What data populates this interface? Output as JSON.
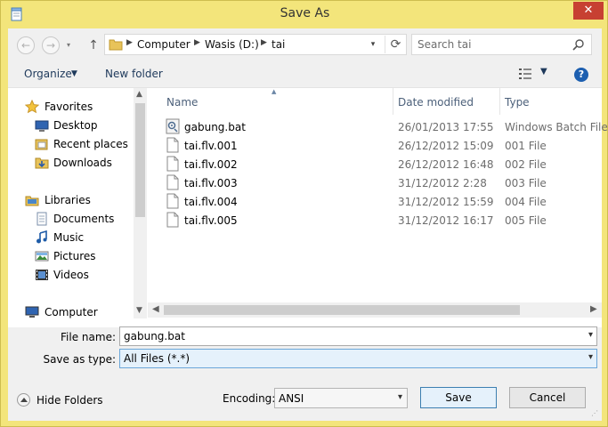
{
  "window": {
    "title": "Save As",
    "close_label": "✕"
  },
  "nav_buttons": {
    "back": "←",
    "forward": "→",
    "up": "↑"
  },
  "address": {
    "crumbs": [
      "Computer",
      "Wasis (D:)",
      "tai"
    ],
    "separator": "▶",
    "refresh": "⟳",
    "dropdown": "▾"
  },
  "search": {
    "placeholder": "Search tai"
  },
  "toolbar": {
    "organize_label": "Organize",
    "new_folder_label": "New folder",
    "help_label": "?"
  },
  "nav_pane": {
    "items": [
      {
        "label": "Favorites",
        "icon": "star-icon"
      },
      {
        "label": "Desktop",
        "icon": "desktop-icon"
      },
      {
        "label": "Recent places",
        "icon": "recent-places-icon"
      },
      {
        "label": "Downloads",
        "icon": "downloads-icon"
      },
      {
        "label": "Libraries",
        "icon": "libraries-icon"
      },
      {
        "label": "Documents",
        "icon": "documents-icon"
      },
      {
        "label": "Music",
        "icon": "music-icon"
      },
      {
        "label": "Pictures",
        "icon": "pictures-icon"
      },
      {
        "label": "Videos",
        "icon": "videos-icon"
      },
      {
        "label": "Computer",
        "icon": "computer-icon"
      }
    ]
  },
  "file_list": {
    "columns": {
      "name": "Name",
      "date": "Date modified",
      "type": "Type"
    },
    "files": [
      {
        "name": "gabung.bat",
        "date": "26/01/2013 17:55",
        "type": "Windows Batch File",
        "icon": "batch-file-icon"
      },
      {
        "name": "tai.flv.001",
        "date": "26/12/2012 15:09",
        "type": "001 File",
        "icon": "file-icon"
      },
      {
        "name": "tai.flv.002",
        "date": "26/12/2012 16:48",
        "type": "002 File",
        "icon": "file-icon"
      },
      {
        "name": "tai.flv.003",
        "date": "31/12/2012 2:28",
        "type": "003 File",
        "icon": "file-icon"
      },
      {
        "name": "tai.flv.004",
        "date": "31/12/2012 15:59",
        "type": "004 File",
        "icon": "file-icon"
      },
      {
        "name": "tai.flv.005",
        "date": "31/12/2012 16:17",
        "type": "005 File",
        "icon": "file-icon"
      }
    ]
  },
  "save_fields": {
    "file_name_label": "File name:",
    "file_name_value": "gabung.bat",
    "save_type_label": "Save as type:",
    "save_type_value": "All Files  (*.*)"
  },
  "bottom": {
    "hide_folders_label": "Hide Folders",
    "encoding_label": "Encoding:",
    "encoding_value": "ANSI",
    "save_label": "Save",
    "cancel_label": "Cancel"
  },
  "colors": {
    "title_bar": "#f3e57b",
    "close_button": "#c74032",
    "accent": "#3c7fb1"
  }
}
